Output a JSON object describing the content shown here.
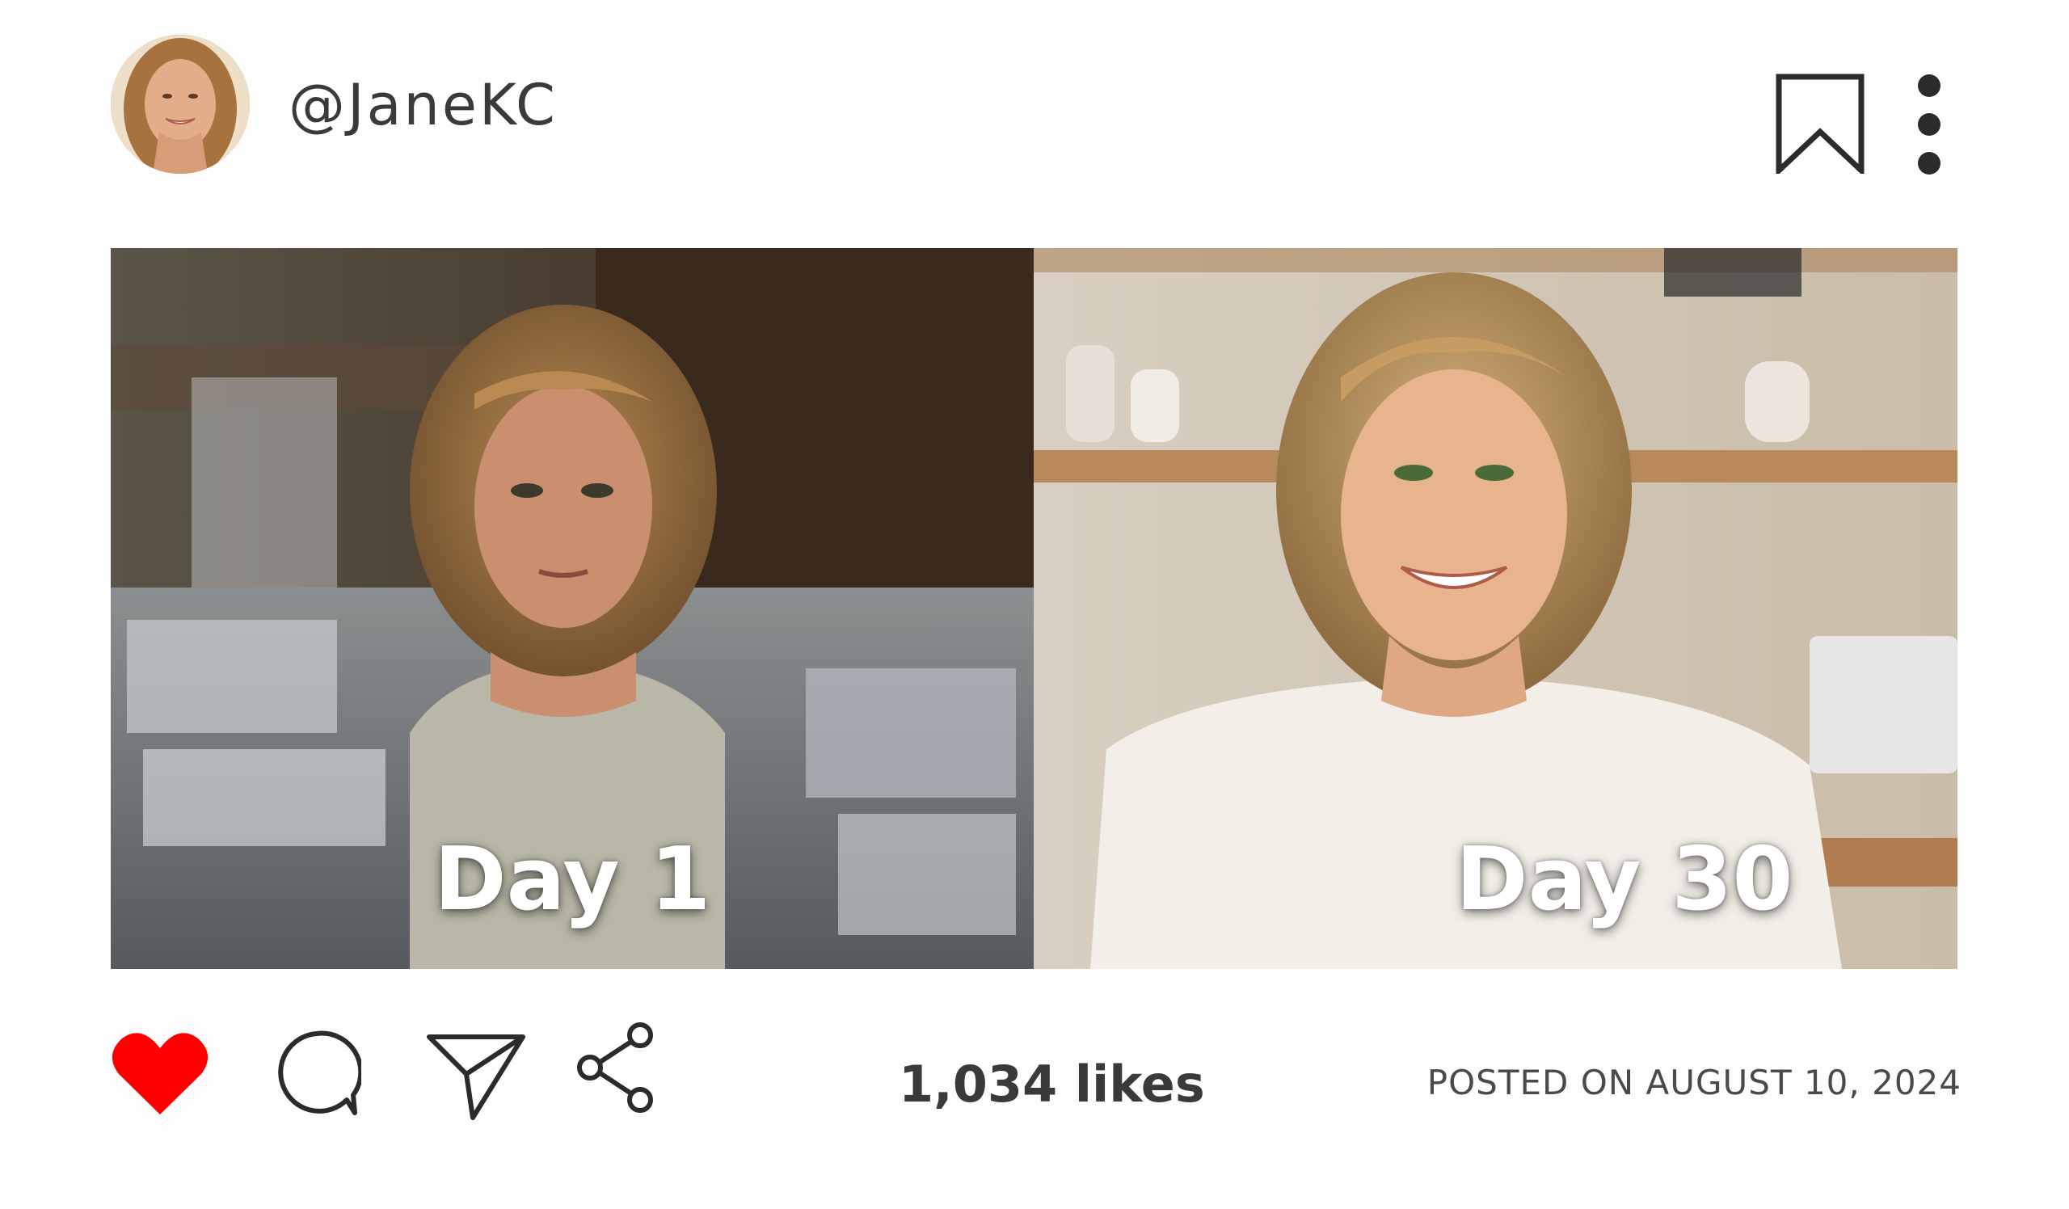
{
  "post": {
    "username": "@JaneKC",
    "avatar_icon": "profile-avatar",
    "header_icons": [
      "bookmark-icon",
      "more-vertical-icon"
    ],
    "photos": [
      {
        "label": "Day 1"
      },
      {
        "label": "Day 30"
      }
    ],
    "actions": {
      "icons": [
        "heart-icon",
        "comment-icon",
        "send-icon",
        "share-icon"
      ],
      "heart_color": "#ff0000",
      "likes": "1,034 likes",
      "posted": "POSTED ON AUGUST 10, 2024"
    }
  }
}
